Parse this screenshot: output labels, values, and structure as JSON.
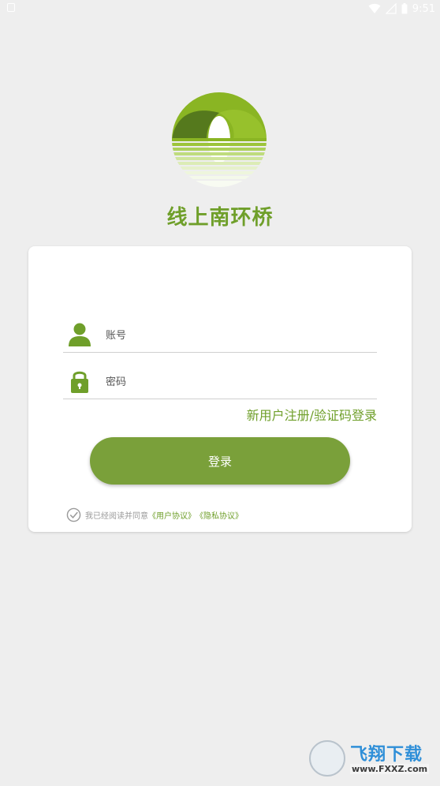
{
  "status_bar": {
    "time": "9:51"
  },
  "app": {
    "name": "线上南环桥"
  },
  "login": {
    "account_placeholder": "账号",
    "password_placeholder": "密码",
    "register_link": "新用户注册/验证码登录",
    "submit_label": "登录"
  },
  "agreement": {
    "prefix": "我已经阅读并同意",
    "user_agreement": "《用户协议》",
    "privacy_agreement": "《隐私协议》"
  },
  "watermark": {
    "title": "飞翔下载",
    "url": "www.FXXZ.com"
  },
  "colors": {
    "brand_green": "#6f9f2a",
    "button_green": "#7aa03a",
    "background": "#eeeeee"
  }
}
